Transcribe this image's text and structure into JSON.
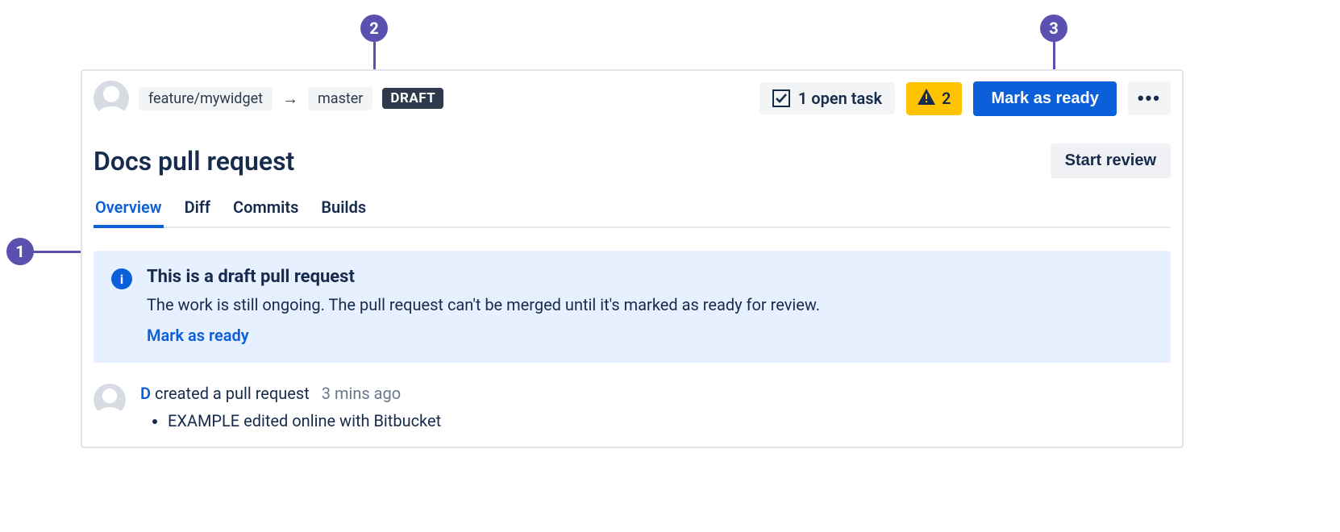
{
  "header": {
    "sourceBranch": "feature/mywidget",
    "arrow": "→",
    "targetBranch": "master",
    "draftBadge": "DRAFT",
    "tasks": {
      "label": "1 open task"
    },
    "warning": {
      "count": "2"
    },
    "markReady": "Mark as ready"
  },
  "title": "Docs pull request",
  "startReview": "Start review",
  "tabs": {
    "overview": "Overview",
    "diff": "Diff",
    "commits": "Commits",
    "builds": "Builds"
  },
  "banner": {
    "title": "This is a draft pull request",
    "body": "The work is still ongoing. The pull request can't be merged until it's marked as ready for review.",
    "action": "Mark as ready"
  },
  "activity": {
    "author": "D",
    "text": "created a pull request",
    "time": "3 mins ago",
    "bullet": "EXAMPLE edited online with Bitbucket"
  },
  "callouts": {
    "c1": "1",
    "c2": "2",
    "c3": "3"
  }
}
